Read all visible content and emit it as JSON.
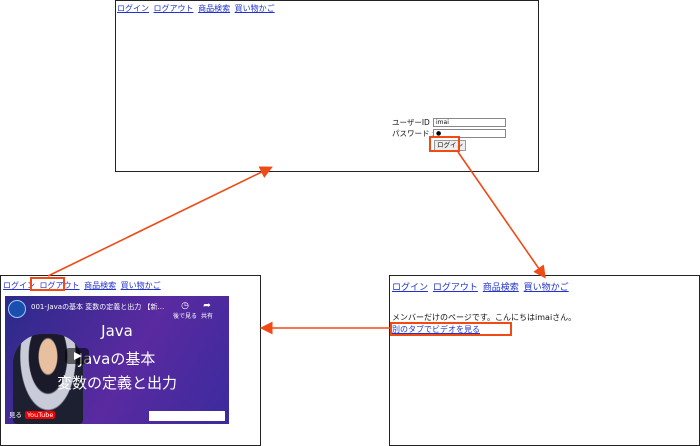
{
  "nav": {
    "login": "ログイン",
    "logout": "ログアウト",
    "search": "商品検索",
    "cart": "買い物かご"
  },
  "login_form": {
    "user_label": "ユーザーID :",
    "user_value": "imai",
    "pass_label": "パスワード :",
    "pass_value": "●",
    "button": "ログイン"
  },
  "member_page": {
    "message": "メンバーだけのページです。こんにちはimaiさん。",
    "link": "別のタブでビデオを見る"
  },
  "video": {
    "title": "001-Javaの基本 変数の定義と出力 【新...",
    "line1": "Java",
    "line2": "Javaの基本",
    "line3": "変数の定義と出力",
    "watch_later": "後で見る",
    "share": "共有",
    "watch_on": "見る",
    "youtube": "YouTube"
  },
  "colors": {
    "arrow": "#f04a17",
    "link": "#2233cc"
  }
}
